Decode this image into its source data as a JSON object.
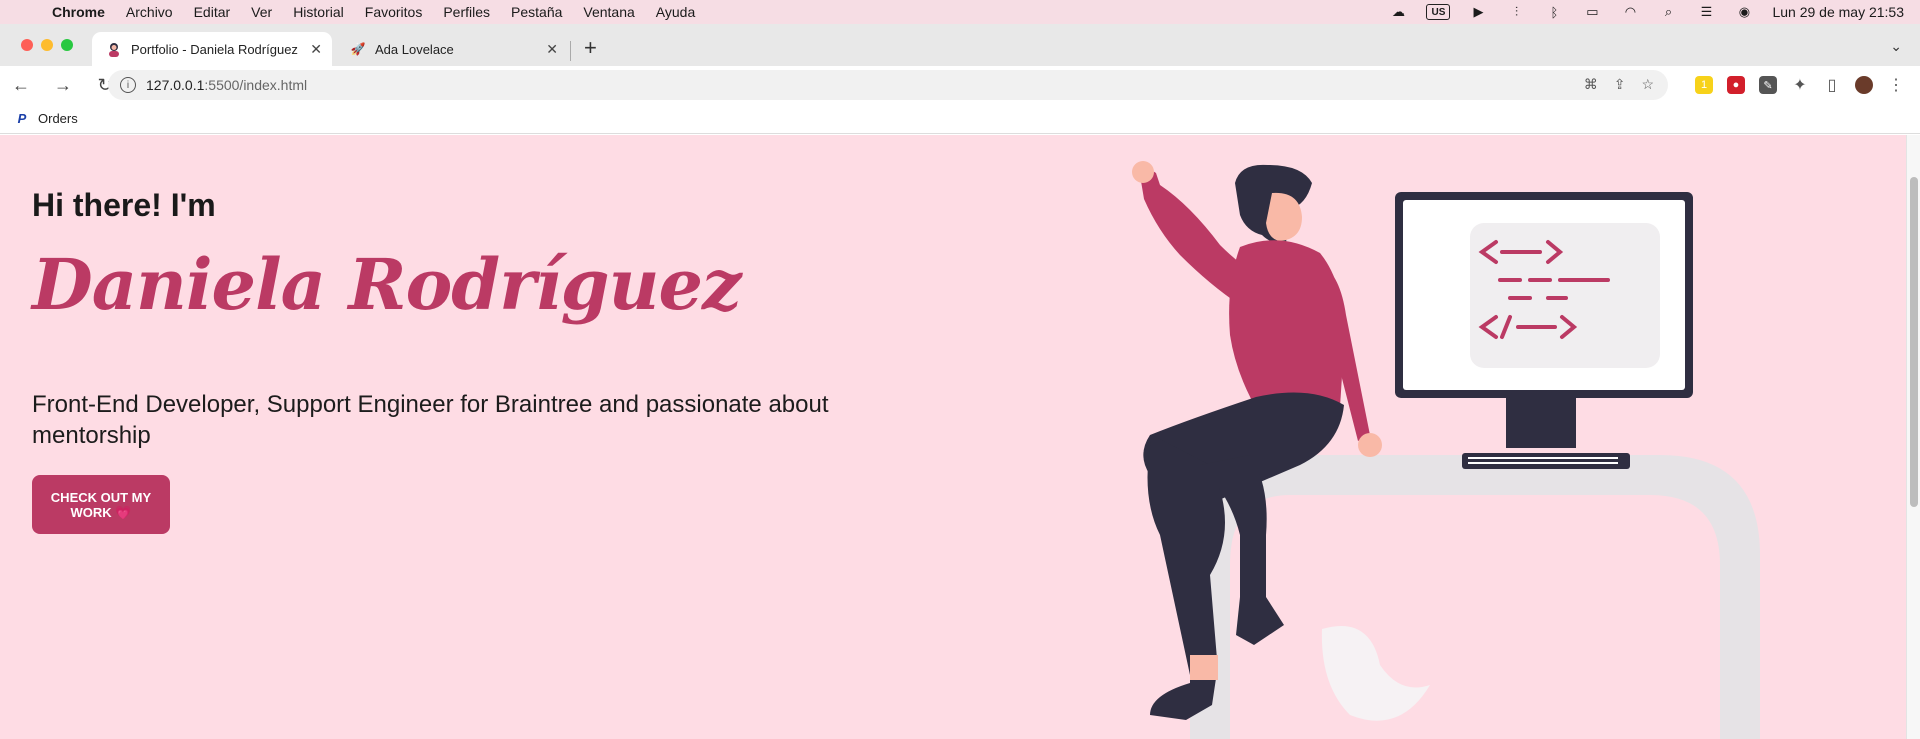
{
  "menubar": {
    "app": "Chrome",
    "items": [
      "Archivo",
      "Editar",
      "Ver",
      "Historial",
      "Favoritos",
      "Perfiles",
      "Pestaña",
      "Ventana",
      "Ayuda"
    ],
    "keyboard_layout": "US",
    "datetime": "Lun 29 de may  21:53"
  },
  "tabs": [
    {
      "title": "Portfolio - Daniela Rodríguez",
      "active": true
    },
    {
      "title": "Ada Lovelace",
      "active": false
    }
  ],
  "omnibox": {
    "host": "127.0.0.1",
    "port_path": ":5500/index.html"
  },
  "bookmarks": [
    {
      "label": "Orders"
    }
  ],
  "hero": {
    "greeting": "Hi there! I'm",
    "name": "Daniela Rodríguez",
    "description": "Front-End Developer, Support Engineer for Braintree and passionate about mentorship",
    "cta": "CHECK OUT MY WORK 💗"
  },
  "colors": {
    "accent": "#bb3a64",
    "background": "#fedce4",
    "dark": "#2f2e41"
  }
}
